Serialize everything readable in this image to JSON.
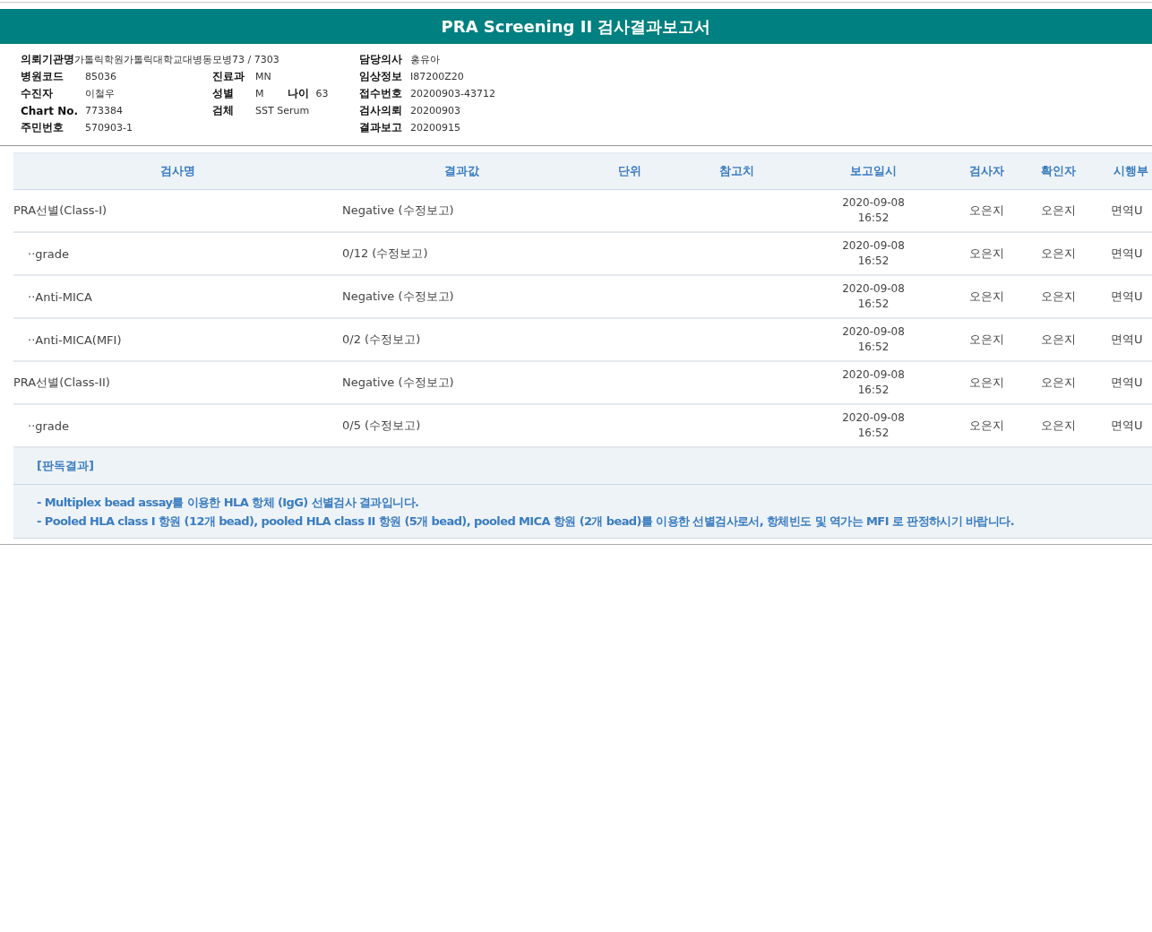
{
  "title": "PRA Screening II 검사결과보고서",
  "info": [
    {
      "left": {
        "label": "의뢰기관명",
        "value": "가톨릭학원가톨릭대학교대병동모병73 / 7303"
      },
      "right": {
        "label": "담당의사",
        "value": "홍유아"
      }
    },
    {
      "left": {
        "label": "병원코드",
        "value": "85036"
      },
      "middle": {
        "label": "진료과",
        "value": "MN"
      },
      "right": {
        "label": "임상정보",
        "value": "I87200Z20"
      }
    },
    {
      "left": {
        "label": "수진자",
        "value": "이철우"
      },
      "middle": {
        "label": "성별",
        "value": "M",
        "extra_label": "나이",
        "extra_value": "63"
      },
      "right": {
        "label": "접수번호",
        "value": "20200903-43712"
      }
    },
    {
      "left": {
        "label": "Chart No.",
        "value": "773384"
      },
      "middle": {
        "label": "검체",
        "value": "SST Serum"
      },
      "right": {
        "label": "검사의뢰",
        "value": "20200903"
      }
    },
    {
      "left": {
        "label": "주민번호",
        "value": "570903-1"
      },
      "right": {
        "label": "결과보고",
        "value": "20200915"
      }
    }
  ],
  "table": {
    "columns": [
      "검사명",
      "결과값",
      "단위",
      "참고치",
      "보고일시",
      "검사자",
      "확인자",
      "시행부"
    ],
    "rows": [
      {
        "name": "PRA선별(Class-I)",
        "result": "Negative (수정보고)",
        "date": "2020-09-08",
        "time": "16:52",
        "tester": "오은지",
        "confirmer": "오은지",
        "department": "면역U",
        "children": [
          {
            "name": "··grade",
            "result": "0/12 (수정보고)",
            "date": "2020-09-08",
            "time": "16:52",
            "tester": "오은지",
            "confirmer": "오은지",
            "department": "면역U"
          },
          {
            "name": "··Anti-MICA",
            "result": "Negative (수정보고)",
            "date": "2020-09-08",
            "time": "16:52",
            "tester": "오은지",
            "confirmer": "오은지",
            "department": "면역U"
          },
          {
            "name": "··Anti-MICA(MFI)",
            "result": "0/2 (수정보고)",
            "date": "2020-09-08",
            "time": "16:52",
            "tester": "오은지",
            "confirmer": "오은지",
            "department": "면역U"
          }
        ]
      },
      {
        "name": "PRA선별(Class-II)",
        "result": "Negative (수정보고)",
        "date": "2020-09-08",
        "time": "16:52",
        "tester": "오은지",
        "confirmer": "오은지",
        "department": "면역U",
        "children": [
          {
            "name": "··grade",
            "result": "0/5 (수정보고)",
            "date": "2020-09-08",
            "time": "16:52",
            "tester": "오은지",
            "confirmer": "오은지",
            "department": "면역U"
          }
        ]
      }
    ]
  },
  "interpretation": {
    "heading": "[판독결과]",
    "lines": [
      "- Multiplex bead assay를 이용한 HLA 항체 (IgG) 선별검사 결과입니다.",
      "- Pooled HLA class I 항원 (12개 bead), pooled HLA class II 항원 (5개 bead), pooled MICA 항원 (2개 bead)를 이용한 선별검사로서, 항체빈도 및 역가는 MFI 로 판정하시기 바랍니다."
    ]
  }
}
